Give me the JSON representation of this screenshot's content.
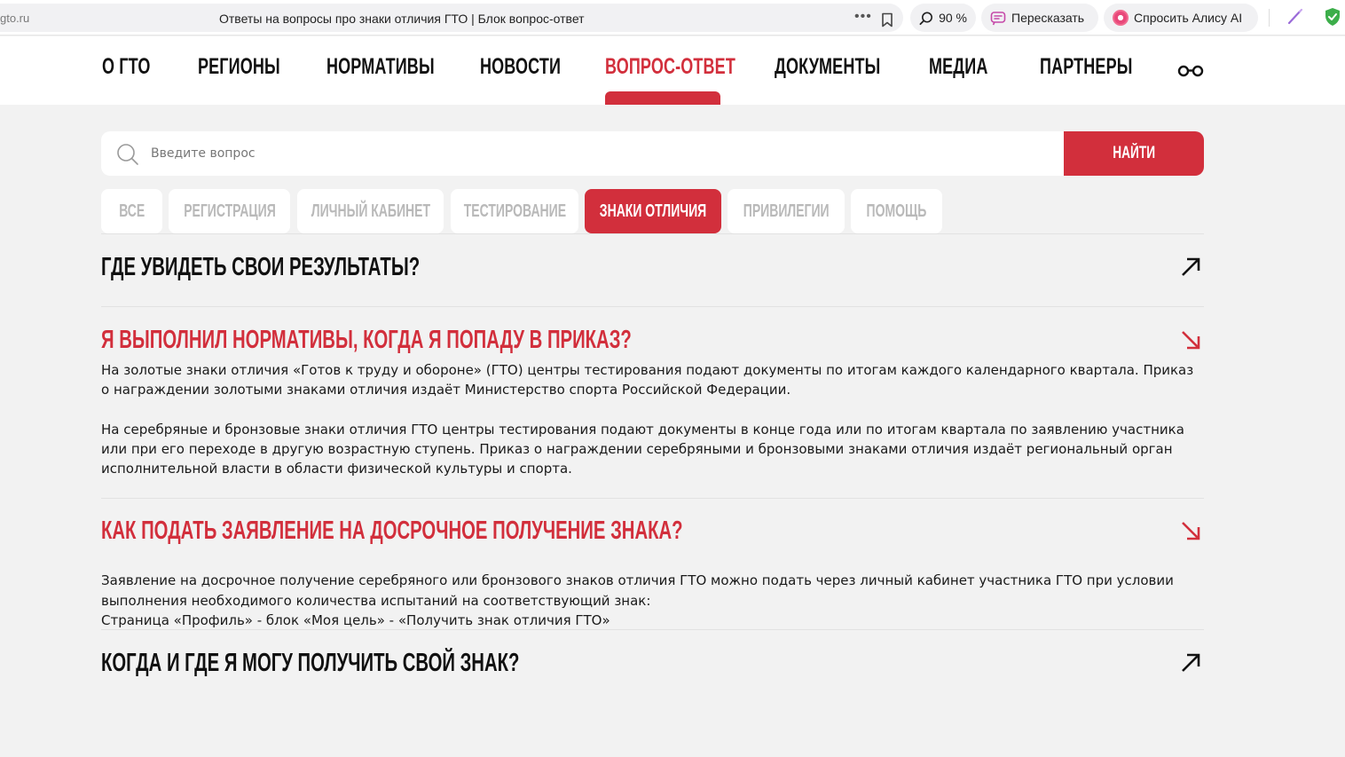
{
  "browser": {
    "url": "gto.ru",
    "title": "Ответы на вопросы про знаки отличия ГТО | Блок вопрос-ответ",
    "more_icon": "ellipsis-icon",
    "bookmark_icon": "bookmark-icon",
    "zoom": "90 %",
    "retell_label": "Пересказать",
    "alice_label": "Спросить Алису AI",
    "accent": "#e8487a"
  },
  "nav": {
    "items": [
      "О ГТО",
      "РЕГИОНЫ",
      "НОРМАТИВЫ",
      "НОВОСТИ",
      "ВОПРОС-ОТВЕТ",
      "ДОКУМЕНТЫ",
      "МЕДИА",
      "ПАРТНЕРЫ"
    ],
    "active": "ВОПРОС-ОТВЕТ",
    "accessibility_icon": "glasses-icon"
  },
  "search": {
    "placeholder": "Введите вопрос",
    "value": "",
    "button_label": "НАЙТИ"
  },
  "tabs": {
    "items": [
      "ВСЕ",
      "РЕГИСТРАЦИЯ",
      "ЛИЧНЫЙ КАБИНЕТ",
      "ТЕСТИРОВАНИЕ",
      "ЗНАКИ ОТЛИЧИЯ",
      "ПРИВИЛЕГИИ",
      "ПОМОЩЬ"
    ],
    "active": "ЗНАКИ ОТЛИЧИЯ"
  },
  "faq": [
    {
      "question": "ГДЕ УВИДЕТЬ СВОИ РЕЗУЛЬТАТЫ?",
      "expanded": false,
      "answer": []
    },
    {
      "question": "Я ВЫПОЛНИЛ НОРМАТИВЫ, КОГДА Я ПОПАДУ В ПРИКАЗ?",
      "expanded": true,
      "answer": [
        "На золотые знаки отличия «Готов к труду и обороне» (ГТО) центры тестирования подают документы по итогам каждого календарного квартала. Приказ о награждении золотыми знаками отличия издаёт Министерство спорта Российской Федерации.",
        "На серебряные и бронзовые знаки отличия ГТО центры тестирования подают документы в конце года или по итогам квартала по заявлению участника или при его переходе в другую возрастную ступень. Приказ о награждении серебряными и бронзовыми знаками отличия издаёт региональный орган исполнительной власти в области физической культуры и спорта."
      ]
    },
    {
      "question": "КАК ПОДАТЬ ЗАЯВЛЕНИЕ НА ДОСРОЧНОЕ ПОЛУЧЕНИЕ ЗНАКА?",
      "expanded": true,
      "answer": [
        "Заявление на досрочное получение серебряного или бронзового знаков отличия ГТО можно подать через личный кабинет участника ГТО при условии выполнения необходимого количества испытаний на соответствующий знак:\nСтраница «Профиль» - блок «Моя цель» - «Получить знак отличия ГТО»"
      ]
    },
    {
      "question": "КОГДА И ГДЕ Я МОГУ ПОЛУЧИТЬ СВОЙ ЗНАК?",
      "expanded": false,
      "answer": []
    }
  ],
  "colors": {
    "brand": "#d22f3c",
    "background": "#f2f2f2",
    "inactive_tab_text": "#b9b9b9"
  }
}
